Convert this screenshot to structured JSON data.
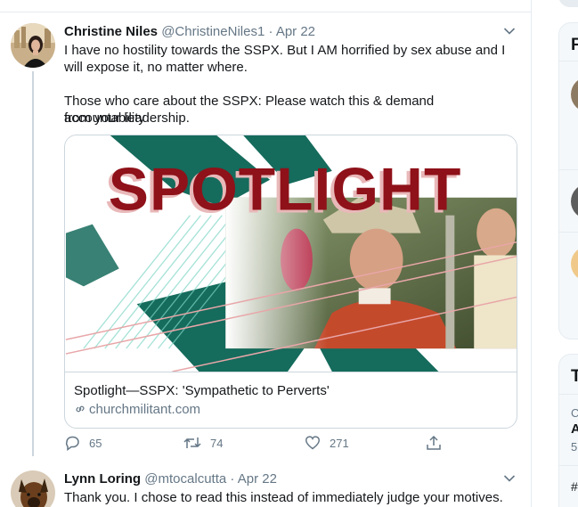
{
  "tweet1": {
    "name": "Christine Niles",
    "handle": "@ChristineNiles1",
    "separator": "·",
    "date": "Apr 22",
    "line1": "I have no hostility towards the SSPX. But I AM horrified by sex abuse and I",
    "line2": "will expose it, no matter where.",
    "line3": "Those who care about the SSPX: Please watch this & demand accountability",
    "line4": "from your leadership.",
    "card": {
      "image_text": "SPOTLIGHT",
      "title": "Spotlight—SSPX: 'Sympathetic to Perverts'",
      "domain": "churchmilitant.com"
    },
    "actions": {
      "replies": "65",
      "retweets": "74",
      "likes": "271"
    }
  },
  "tweet2": {
    "name": "Lynn Loring",
    "handle": "@mtocalcutta",
    "separator": "·",
    "date": "Apr 22",
    "line1": "Thank you. I chose to read this instead of immediately judge your motives."
  },
  "sidebar": {
    "letters": [
      "F",
      "T",
      "C",
      "A",
      "5",
      "#"
    ]
  },
  "colors": {
    "accent": "#1da1f2",
    "spotlight_red": "#a3141c",
    "teal": "#156b5c",
    "secondary_text": "#657786"
  }
}
